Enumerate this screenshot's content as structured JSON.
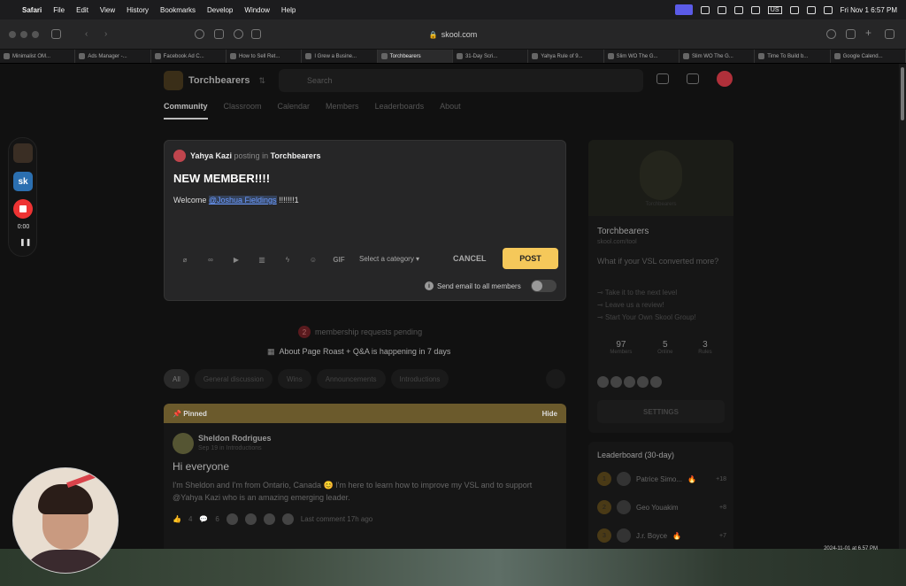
{
  "menubar": {
    "app": "Safari",
    "items": [
      "File",
      "Edit",
      "View",
      "History",
      "Bookmarks",
      "Develop",
      "Window",
      "Help"
    ],
    "clock": "Fri Nov 1  6:57 PM",
    "lang": "US"
  },
  "toolbar": {
    "url": "skool.com"
  },
  "tabs": [
    "Minimalist OM...",
    "Ads Manager -...",
    "Facebook Ad C...",
    "How to Sell Ret...",
    "I Grew a Busine...",
    "Torchbearers",
    "31-Day Scri...",
    "Yahya Rule of 9...",
    "Slim WO The G...",
    "Slim WO The G...",
    "Time To Build b...",
    "Google Calend..."
  ],
  "header": {
    "group_name": "Torchbearers",
    "search_placeholder": "Search"
  },
  "nav": [
    "Community",
    "Classroom",
    "Calendar",
    "Members",
    "Leaderboards",
    "About"
  ],
  "composer": {
    "author": "Yahya Kazi",
    "posting_in": "posting in",
    "group": "Torchbearers",
    "title": "NEW MEMBER!!!!",
    "welcome": "Welcome",
    "mention": "@Joshua Fieldings",
    "suffix": " !!!!!!!1",
    "gif": "GIF",
    "category": "Select a category",
    "cancel": "CANCEL",
    "post": "POST",
    "send_email": "Send email to all members"
  },
  "pending": {
    "count": "2",
    "text": "membership requests pending"
  },
  "event": {
    "text": "About Page Roast + Q&A is happening in 7 days"
  },
  "filters": [
    "All",
    "General discussion",
    "Wins",
    "Announcements",
    "Introductions"
  ],
  "pinned": {
    "label": "Pinned",
    "hide": "Hide",
    "author": "Sheldon Rodrigues",
    "meta": "Sep 19 in Introductions",
    "title": "Hi everyone",
    "text": "I'm Sheldon and I'm from Ontario, Canada 😊 I'm here to learn how to improve my VSL and to support @Yahya Kazi who is an amazing emerging leader.",
    "likes": "4",
    "comments": "6",
    "last_comment": "Last comment 17h ago"
  },
  "side": {
    "cover_caption": "Torchbearers",
    "name": "Torchbearers",
    "url": "skool.com/tool",
    "desc": "What if your VSL converted more?",
    "links": [
      "Take it to the next level",
      "Leave us a review!",
      "Start Your Own Skool Group!"
    ],
    "stats": [
      {
        "n": "97",
        "l": "Members"
      },
      {
        "n": "5",
        "l": "Online"
      },
      {
        "n": "3",
        "l": "Rules"
      }
    ],
    "settings": "SETTINGS"
  },
  "leaderboard": {
    "title": "Leaderboard (30-day)",
    "rows": [
      {
        "rank": "1",
        "name": "Patrice Simo...",
        "pts": "+18"
      },
      {
        "rank": "2",
        "name": "Geo Youakim",
        "pts": "+8"
      },
      {
        "rank": "3",
        "name": "J.r. Boyce",
        "pts": "+7"
      }
    ]
  },
  "recorder": {
    "time": "0:00",
    "pause": "❚❚"
  },
  "stamp": "2024-11-01 at 6.57 PM",
  "colors": {
    "accent": "#f5c85a",
    "record": "#ee3333",
    "pinned_bar": "#6b5a2c"
  }
}
